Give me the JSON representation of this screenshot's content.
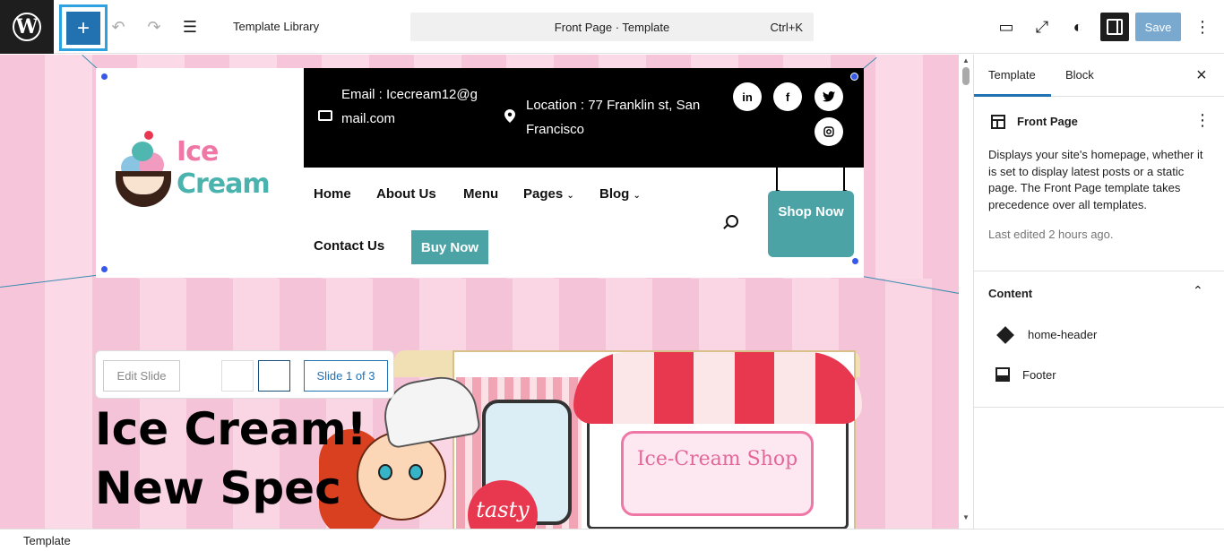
{
  "toolbar": {
    "add_label": "+",
    "template_library": "Template Library",
    "command_title": "Front Page · Template",
    "command_shortcut": "Ctrl+K",
    "save_label": "Save"
  },
  "site": {
    "logo_word1": "Ice",
    "logo_word2": "Cream",
    "email_text": "Email : Icecream12@gmail.com",
    "location_text": "Location : 77 Franklin st, San Francisco",
    "social": [
      "in",
      "f",
      "t",
      "ig"
    ],
    "nav": [
      "Home",
      "About Us",
      "Menu",
      "Pages",
      "Blog",
      "Contact Us"
    ],
    "buy_now": "Buy Now",
    "shop_now": "Shop Now",
    "slide_edit": "Edit Slide",
    "slide_count": "Slide 1 of 3",
    "hero_line1": "Ice Cream!",
    "hero_line2": "New Spec",
    "sign_text": "Ice-Cream Shop",
    "tasty": "tasty"
  },
  "sidebar": {
    "tab_template": "Template",
    "tab_block": "Block",
    "template_name": "Front Page",
    "description": "Displays your site's homepage, whether it is set to display latest posts or a static page. The Front Page template takes precedence over all templates.",
    "last_edited": "Last edited 2 hours ago.",
    "content_title": "Content",
    "content_items": [
      "home-header",
      "Footer"
    ]
  },
  "statusbar": {
    "label": "Template"
  },
  "colors": {
    "accent": "#2271b1",
    "brand_teal": "#4ba3a6",
    "brand_pink": "#ef77a5"
  }
}
